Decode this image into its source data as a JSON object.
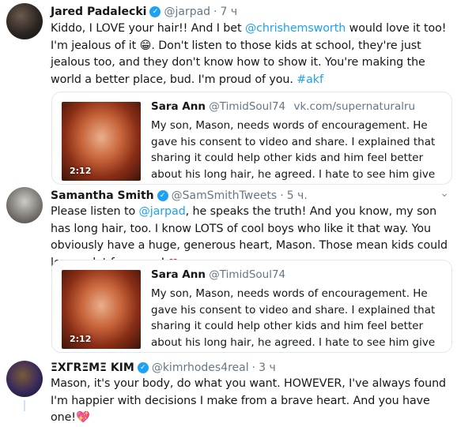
{
  "tweets": [
    {
      "name": "Jared Padalecki",
      "handle": "@jarpad",
      "time": "7 ч",
      "text_parts": [
        "Kiddo, I LOVE your hair!! And I bet ",
        "@chrishemsworth",
        " would love it too! I'm jealous of it 😁. Don't listen to those kids at school, they're just jealous too, and they don't know how to show it. You're making the world a better place, bud. I'm proud of you. ",
        "#akf"
      ],
      "quote": {
        "name": "Sara Ann",
        "handle": "@TimidSoul74",
        "source": "vk.com/supernaturalru",
        "duration": "2:12",
        "text": "My son, Mason, needs words of encouragement. He gave his consent to video and share. I explained that sharing it could help other kids and him feel better about his long hair, he agreed. I hate to see him give up. In a ponytail,..."
      }
    },
    {
      "name": "Samantha Smith",
      "handle": "@SamSmithTweets",
      "time": "5 ч.",
      "text_parts": [
        "Please listen to ",
        "@jarpad",
        ", he speaks the truth! And you know, my son has long hair, too. I know LOTS of cool boys who like it that way. You obviously have a huge, generous heart, Mason. Those mean kids could learn a lot from you! ",
        "❤"
      ],
      "quote": {
        "name": "Sara Ann",
        "handle": "@TimidSoul74",
        "duration": "2:12",
        "text": "My son, Mason, needs words of encouragement. He gave his consent to video and share. I explained that sharing it could help other kids and him feel better about his long hair, he agreed. I hate to see him give up. In a ponytail,..."
      }
    },
    {
      "name": "ΞXΓRΞMΞ KIM",
      "handle": "@kimrhodes4real",
      "time": "3 ч",
      "text_parts": [
        "Mason, it's your body, do what you want. HOWEVER, I've always found I'm happier with decisions I make from a brave heart. And you have one!",
        "💖"
      ]
    }
  ],
  "icons": {
    "verified": "✓",
    "chevron": "⌄"
  },
  "colors": {
    "link": "#1da1f2",
    "muted": "#657786",
    "heart": "#e0245e"
  }
}
